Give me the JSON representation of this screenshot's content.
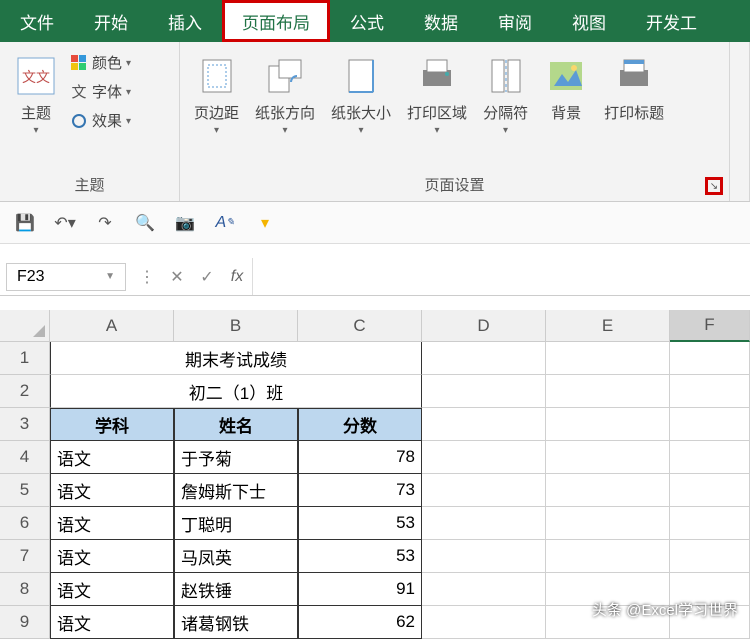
{
  "tabs": [
    "文件",
    "开始",
    "插入",
    "页面布局",
    "公式",
    "数据",
    "审阅",
    "视图",
    "开发工"
  ],
  "active_tab_index": 3,
  "ribbon": {
    "group_themes": {
      "label": "主题",
      "theme": "主题",
      "colors": "颜色",
      "fonts": "字体",
      "effects": "效果"
    },
    "group_page_setup": {
      "label": "页面设置",
      "margins": "页边距",
      "orientation": "纸张方向",
      "size": "纸张大小",
      "print_area": "打印区域",
      "breaks": "分隔符",
      "background": "背景",
      "print_titles": "打印标题"
    }
  },
  "namebox": "F23",
  "columns": [
    "A",
    "B",
    "C",
    "D",
    "E",
    "F"
  ],
  "rows": [
    "1",
    "2",
    "3",
    "4",
    "5",
    "6",
    "7",
    "8",
    "9"
  ],
  "active_col": "F",
  "sheet": {
    "title": "期末考试成绩",
    "subtitle": "初二（1）班",
    "headers": [
      "学科",
      "姓名",
      "分数"
    ],
    "data": [
      [
        "语文",
        "于予菊",
        "78"
      ],
      [
        "语文",
        "詹姆斯下士",
        "73"
      ],
      [
        "语文",
        "丁聪明",
        "53"
      ],
      [
        "语文",
        "马凤英",
        "53"
      ],
      [
        "语文",
        "赵铁锤",
        "91"
      ],
      [
        "语文",
        "诸葛钢铁",
        "62"
      ]
    ]
  },
  "watermark": "头条 @Excel学习世界",
  "chart_data": {
    "type": "table",
    "title": "期末考试成绩",
    "subtitle": "初二（1）班",
    "columns": [
      "学科",
      "姓名",
      "分数"
    ],
    "rows": [
      [
        "语文",
        "于予菊",
        78
      ],
      [
        "语文",
        "詹姆斯下士",
        73
      ],
      [
        "语文",
        "丁聪明",
        53
      ],
      [
        "语文",
        "马凤英",
        53
      ],
      [
        "语文",
        "赵铁锤",
        91
      ],
      [
        "语文",
        "诸葛钢铁",
        62
      ]
    ]
  }
}
